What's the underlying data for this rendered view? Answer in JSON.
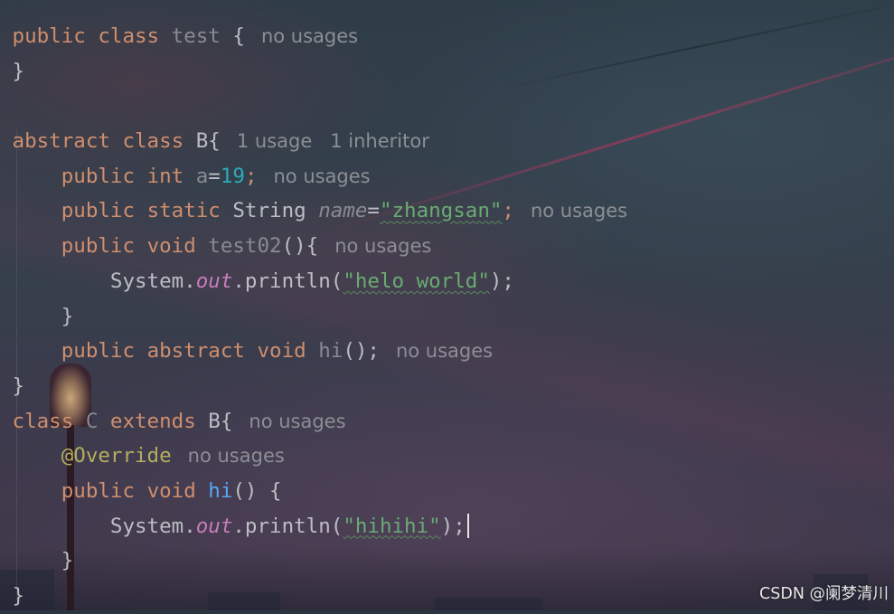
{
  "editor": {
    "lines": [
      {
        "tokens": [
          "public",
          "class",
          "test",
          "{"
        ],
        "hints": [
          "no usages"
        ]
      },
      {
        "tokens": [
          "}"
        ],
        "hints": []
      },
      {
        "tokens": [],
        "hints": []
      },
      {
        "tokens": [
          "abstract",
          "class",
          "B{"
        ],
        "hints": [
          "1 usage",
          "1 inheritor"
        ]
      },
      {
        "tokens": [
          "public",
          "int",
          "a",
          "=",
          "19",
          ";"
        ],
        "hints": [
          "no usages"
        ]
      },
      {
        "tokens": [
          "public",
          "static",
          "String",
          "name",
          "=",
          "\"zhangsan\"",
          ";"
        ],
        "hints": [
          "no usages"
        ]
      },
      {
        "tokens": [
          "public",
          "void",
          "test02",
          "(){"
        ],
        "hints": [
          "no usages"
        ]
      },
      {
        "tokens": [
          "System.",
          "out",
          ".println(",
          "\"helo world\"",
          ");"
        ],
        "hints": []
      },
      {
        "tokens": [
          "}"
        ],
        "hints": []
      },
      {
        "tokens": [
          "public",
          "abstract",
          "void",
          "hi",
          "();"
        ],
        "hints": [
          "no usages"
        ]
      },
      {
        "tokens": [
          "}"
        ],
        "hints": []
      },
      {
        "tokens": [
          "class",
          "C",
          "extends",
          "B{"
        ],
        "hints": [
          "no usages"
        ]
      },
      {
        "tokens": [
          "@Override"
        ],
        "hints": [
          "no usages"
        ]
      },
      {
        "tokens": [
          "public",
          "void",
          "hi",
          "() {"
        ],
        "hints": []
      },
      {
        "tokens": [
          "System.",
          "out",
          ".println(",
          "\"hihihi\"",
          ");"
        ],
        "hints": []
      },
      {
        "tokens": [
          "}"
        ],
        "hints": []
      },
      {
        "tokens": [
          "}"
        ],
        "hints": []
      }
    ]
  },
  "watermark": "CSDN @阑梦清川",
  "colors": {
    "keyword": "#cf8e6d",
    "string": "#6aab73",
    "number": "#2aacb8",
    "field": "#c77dbb",
    "annotation": "#b3ae60",
    "method": "#56a8f5",
    "plain": "#bcbec4",
    "hint": "#8b8f94"
  }
}
